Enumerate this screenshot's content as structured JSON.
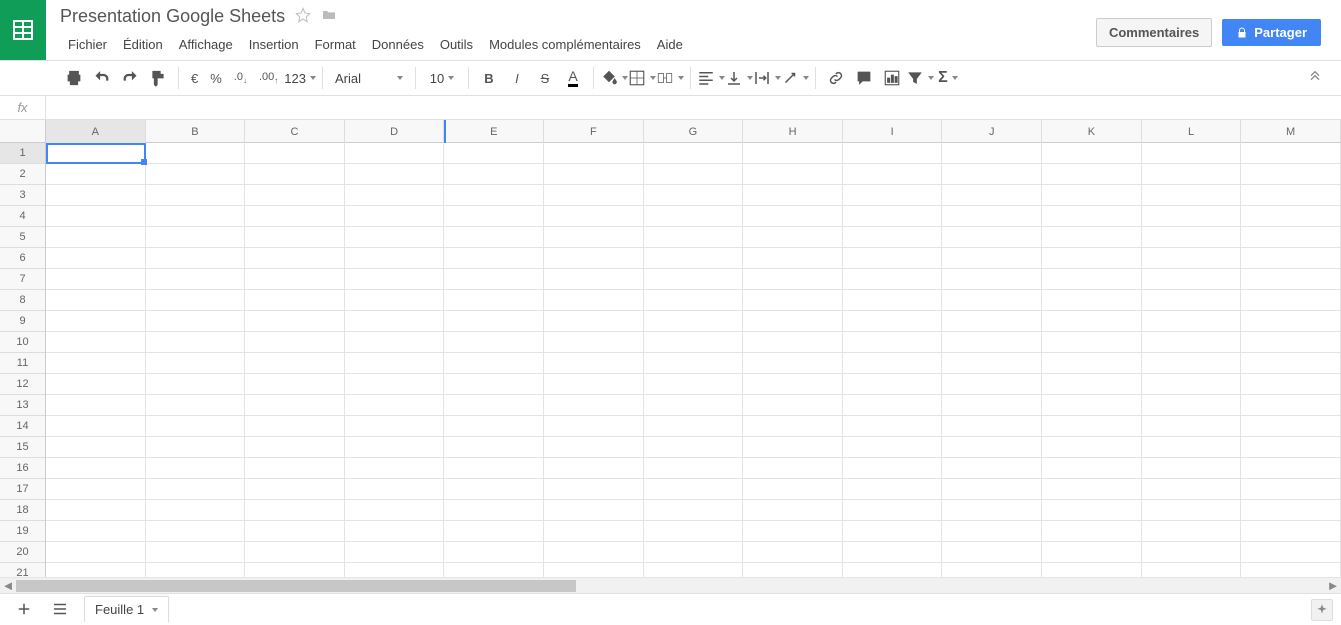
{
  "header": {
    "title": "Presentation Google Sheets",
    "comments_label": "Commentaires",
    "share_label": "Partager"
  },
  "menu": {
    "items": [
      "Fichier",
      "Édition",
      "Affichage",
      "Insertion",
      "Format",
      "Données",
      "Outils",
      "Modules complémentaires",
      "Aide"
    ]
  },
  "toolbar": {
    "currency": "€",
    "percent": "%",
    "dec_dec": ".0",
    "inc_dec": ".00",
    "more_formats": "123",
    "font": "Arial",
    "font_size": "10",
    "bold": "B",
    "italic": "I",
    "strike": "S",
    "text_color": "A"
  },
  "formula": {
    "fx": "fx",
    "value": ""
  },
  "grid": {
    "columns": [
      "A",
      "B",
      "C",
      "D",
      "E",
      "F",
      "G",
      "H",
      "I",
      "J",
      "K",
      "L",
      "M"
    ],
    "rows": [
      "1",
      "2",
      "3",
      "4",
      "5",
      "6",
      "7",
      "8",
      "9",
      "10",
      "11",
      "12",
      "13",
      "14",
      "15",
      "16",
      "17",
      "18",
      "19",
      "20",
      "21"
    ],
    "selected_column": "A",
    "selected_row": "1"
  },
  "tabs": {
    "sheet1": "Feuille 1"
  }
}
